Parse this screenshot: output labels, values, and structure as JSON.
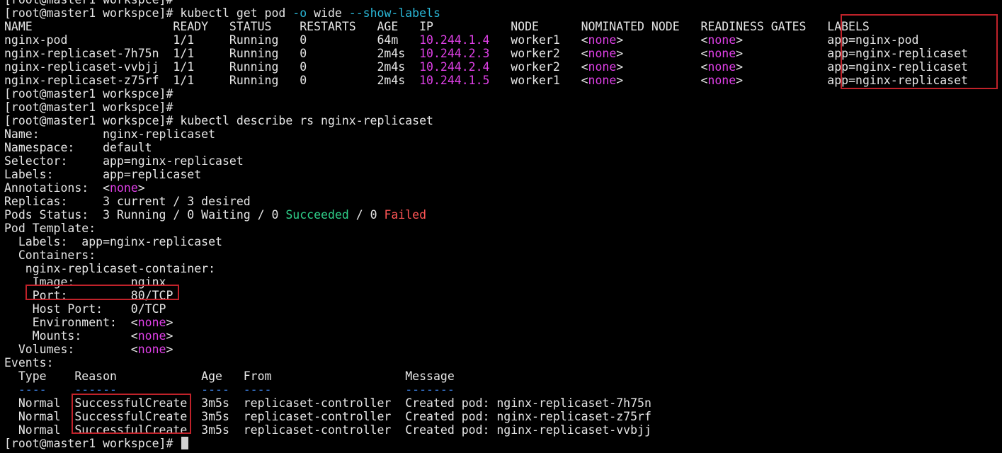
{
  "terminal": {
    "lines": [
      [
        {
          "t": "[root@master1 workspce]# "
        }
      ],
      [
        {
          "t": "[root@master1 workspce]# kubectl get pod "
        },
        {
          "t": "-o",
          "c": "cyan"
        },
        {
          "t": " wide "
        },
        {
          "t": "--show-labels",
          "c": "cyan"
        }
      ],
      [
        {
          "t": "NAME                    READY   STATUS    RESTARTS   AGE   IP           NODE      NOMINATED NODE   READINESS GATES   LABELS"
        }
      ],
      [
        {
          "t": "nginx-pod               1/1     Running   0          64m   "
        },
        {
          "t": "10.244.1.4",
          "c": "magenta"
        },
        {
          "t": "   worker1   <"
        },
        {
          "t": "none",
          "c": "magenta"
        },
        {
          "t": ">           <"
        },
        {
          "t": "none",
          "c": "magenta"
        },
        {
          "t": ">            app=nginx-pod"
        }
      ],
      [
        {
          "t": "nginx-replicaset-7h75n  1/1     Running   0          2m4s  "
        },
        {
          "t": "10.244.2.3",
          "c": "magenta"
        },
        {
          "t": "   worker2   <"
        },
        {
          "t": "none",
          "c": "magenta"
        },
        {
          "t": ">           <"
        },
        {
          "t": "none",
          "c": "magenta"
        },
        {
          "t": ">            app=nginx-replicaset"
        }
      ],
      [
        {
          "t": "nginx-replicaset-vvbjj  1/1     Running   0          2m4s  "
        },
        {
          "t": "10.244.2.4",
          "c": "magenta"
        },
        {
          "t": "   worker2   <"
        },
        {
          "t": "none",
          "c": "magenta"
        },
        {
          "t": ">           <"
        },
        {
          "t": "none",
          "c": "magenta"
        },
        {
          "t": ">            app=nginx-replicaset"
        }
      ],
      [
        {
          "t": "nginx-replicaset-z75rf  1/1     Running   0          2m4s  "
        },
        {
          "t": "10.244.1.5",
          "c": "magenta"
        },
        {
          "t": "   worker1   <"
        },
        {
          "t": "none",
          "c": "magenta"
        },
        {
          "t": ">           <"
        },
        {
          "t": "none",
          "c": "magenta"
        },
        {
          "t": ">            app=nginx-replicaset"
        }
      ],
      [
        {
          "t": "[root@master1 workspce]#"
        }
      ],
      [
        {
          "t": "[root@master1 workspce]#"
        }
      ],
      [
        {
          "t": "[root@master1 workspce]# kubectl describe rs nginx-replicaset"
        }
      ],
      [
        {
          "t": "Name:         nginx-replicaset"
        }
      ],
      [
        {
          "t": "Namespace:    default"
        }
      ],
      [
        {
          "t": "Selector:     app=nginx-replicaset"
        }
      ],
      [
        {
          "t": "Labels:       app=replicaset"
        }
      ],
      [
        {
          "t": "Annotations:  <"
        },
        {
          "t": "none",
          "c": "magenta"
        },
        {
          "t": ">"
        }
      ],
      [
        {
          "t": "Replicas:     3 current / 3 desired"
        }
      ],
      [
        {
          "t": "Pods Status:  3 Running / 0 Waiting / 0 "
        },
        {
          "t": "Succeeded",
          "c": "green"
        },
        {
          "t": " / 0 "
        },
        {
          "t": "Failed",
          "c": "red"
        }
      ],
      [
        {
          "t": "Pod Template:"
        }
      ],
      [
        {
          "t": "  Labels:  app=nginx-replicaset"
        }
      ],
      [
        {
          "t": "  Containers:"
        }
      ],
      [
        {
          "t": "   nginx-replicaset-container:"
        }
      ],
      [
        {
          "t": "    Image:        nginx"
        }
      ],
      [
        {
          "t": "    Port:         80/TCP"
        }
      ],
      [
        {
          "t": "    Host Port:    0/TCP"
        }
      ],
      [
        {
          "t": "    Environment:  <"
        },
        {
          "t": "none",
          "c": "magenta"
        },
        {
          "t": ">"
        }
      ],
      [
        {
          "t": "    Mounts:       <"
        },
        {
          "t": "none",
          "c": "magenta"
        },
        {
          "t": ">"
        }
      ],
      [
        {
          "t": "  Volumes:        <"
        },
        {
          "t": "none",
          "c": "magenta"
        },
        {
          "t": ">"
        }
      ],
      [
        {
          "t": "Events:"
        }
      ],
      [
        {
          "t": "  Type    Reason            Age   From                   Message"
        }
      ],
      [
        {
          "t": "  ----    ------            ----  ----                   -------",
          "c": "blue"
        }
      ],
      [
        {
          "t": "  Normal  SuccessfulCreate  3m5s  replicaset-controller  Created pod: nginx-replicaset-7h75n"
        }
      ],
      [
        {
          "t": "  Normal  SuccessfulCreate  3m5s  replicaset-controller  Created pod: nginx-replicaset-z75rf"
        }
      ],
      [
        {
          "t": "  Normal  SuccessfulCreate  3m5s  replicaset-controller  Created pod: nginx-replicaset-vvbjj"
        }
      ],
      [
        {
          "t": "[root@master1 workspce]# ",
          "cursor": true
        }
      ]
    ]
  },
  "colors": {
    "background": "#000000",
    "text": "#e6e6e6",
    "magenta": "#e040e8",
    "cyan": "#2ab8d8",
    "green": "#2fd08a",
    "red": "#ff5555",
    "blue": "#3a7ad8",
    "highlight_box": "#c0222a"
  }
}
